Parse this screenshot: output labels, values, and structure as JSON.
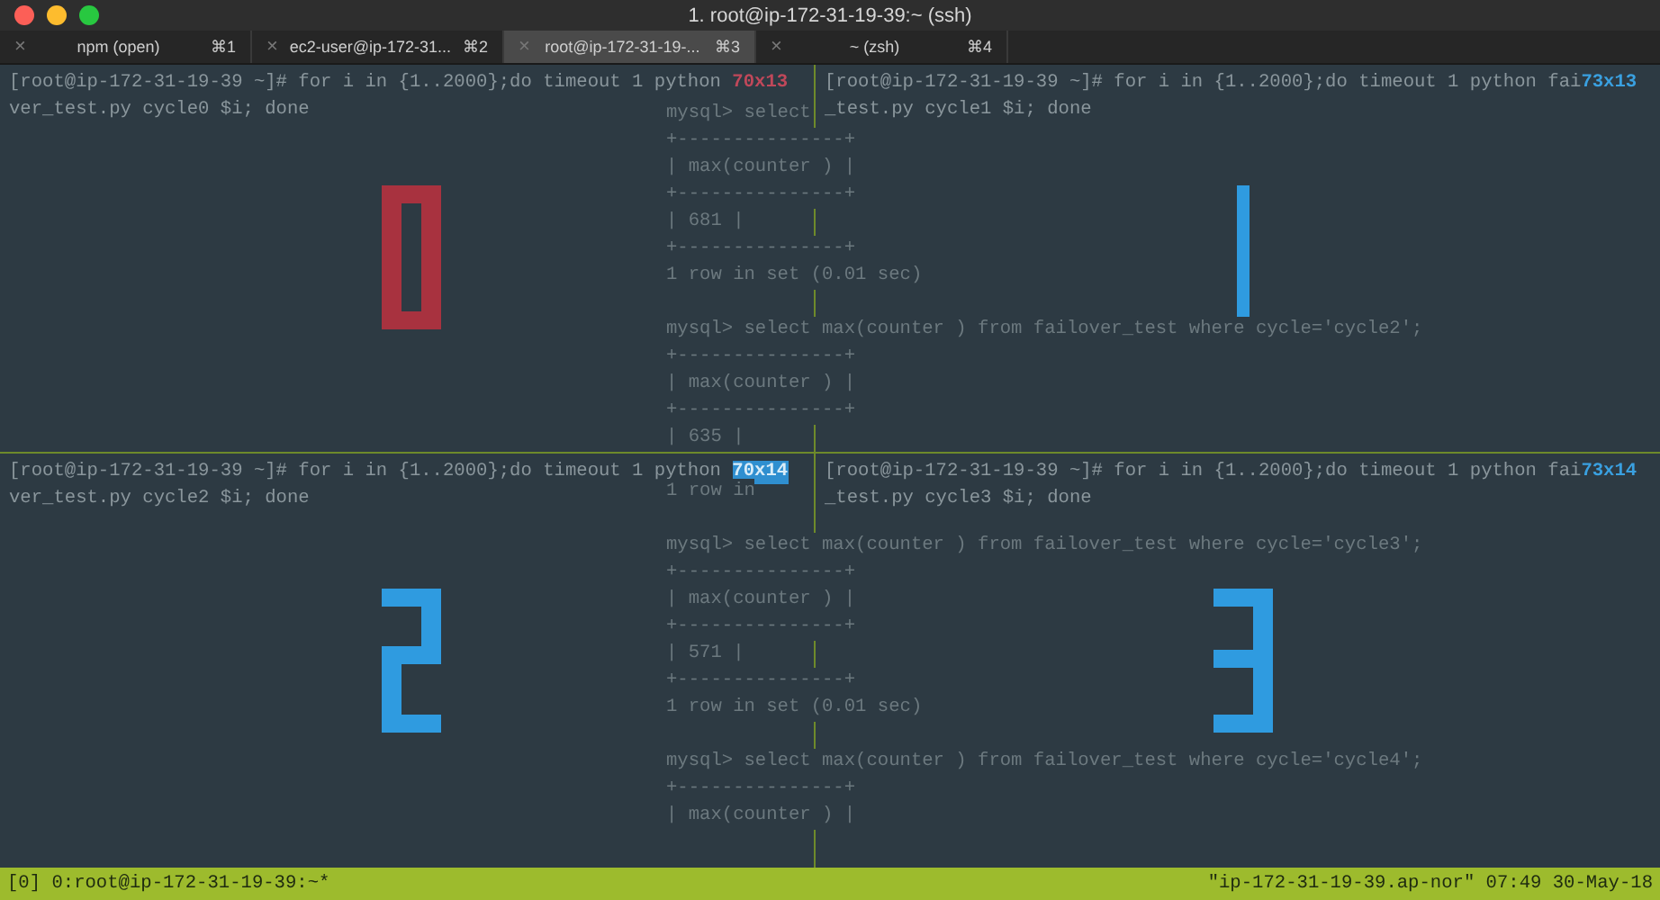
{
  "window": {
    "title": "1. root@ip-172-31-19-39:~ (ssh)"
  },
  "tabs": [
    {
      "close": "×",
      "label": "npm (open)",
      "shortcut": "⌘1",
      "selected": false
    },
    {
      "close": "×",
      "label": "ec2-user@ip-172-31...",
      "shortcut": "⌘2",
      "selected": false
    },
    {
      "close": "×",
      "label": "root@ip-172-31-19-...",
      "shortcut": "⌘3",
      "selected": true
    },
    {
      "close": "×",
      "label": "~ (zsh)",
      "shortcut": "⌘4",
      "selected": false
    }
  ],
  "panes": [
    {
      "command": "[root@ip-172-31-19-39 ~]# for i in {1..2000};do timeout 1 python ",
      "size_label": {
        "text": "70x13",
        "color": "#c0485a",
        "highlighted": false
      },
      "continuation": "ver_test.py cycle0 $i; done",
      "figure": {
        "kind": "zero",
        "color": "#a8323f"
      }
    },
    {
      "command": "[root@ip-172-31-19-39 ~]# for i in {1..2000};do timeout 1 python fai",
      "size_label": {
        "text": "73x13",
        "color": "#3aa0e0",
        "highlighted": false
      },
      "continuation": "_test.py cycle1 $i; done",
      "figure": {
        "kind": "one",
        "color": "#2f9be0"
      }
    },
    {
      "command": "[root@ip-172-31-19-39 ~]# for i in {1..2000};do timeout 1 python ",
      "size_label": {
        "text": "70x14",
        "color": "#2f8fd0",
        "highlighted": true
      },
      "continuation": "ver_test.py cycle2 $i; done",
      "figure": {
        "kind": "two",
        "color": "#2f9be0"
      }
    },
    {
      "command": "[root@ip-172-31-19-39 ~]# for i in {1..2000};do timeout 1 python fai",
      "size_label": {
        "text": "73x14",
        "color": "#3aa0e0",
        "highlighted": false
      },
      "continuation": "_test.py cycle3 $i; done",
      "figure": {
        "kind": "three",
        "color": "#2f9be0"
      }
    }
  ],
  "background_output": [
    [
      "mysql> select",
      "+---------------+",
      "| max(counter ) |",
      "+---------------+",
      "| 681 |",
      "+---------------+",
      "1 row in set (0.01 sec)"
    ],
    [
      "mysql> select max(counter ) from failover_test where cycle='cycle2';",
      "+---------------+",
      "| max(counter ) |",
      "+---------------+",
      "| 635 |"
    ],
    [
      "1 row in"
    ],
    [
      "mysql> select max(counter ) from failover_test where cycle='cycle3';",
      "+---------------+",
      "| max(counter ) |",
      "+---------------+",
      "| 571 |",
      "+---------------+",
      "1 row in set (0.01 sec)"
    ],
    [
      "mysql> select max(counter ) from failover_test where cycle='cycle4';",
      "+---------------+",
      "| max(counter ) |"
    ]
  ],
  "status_bar": {
    "left": "[0] 0:root@ip-172-31-19-39:~*",
    "right": "\"ip-172-31-19-39.ap-nor\" 07:49 30-May-18"
  }
}
